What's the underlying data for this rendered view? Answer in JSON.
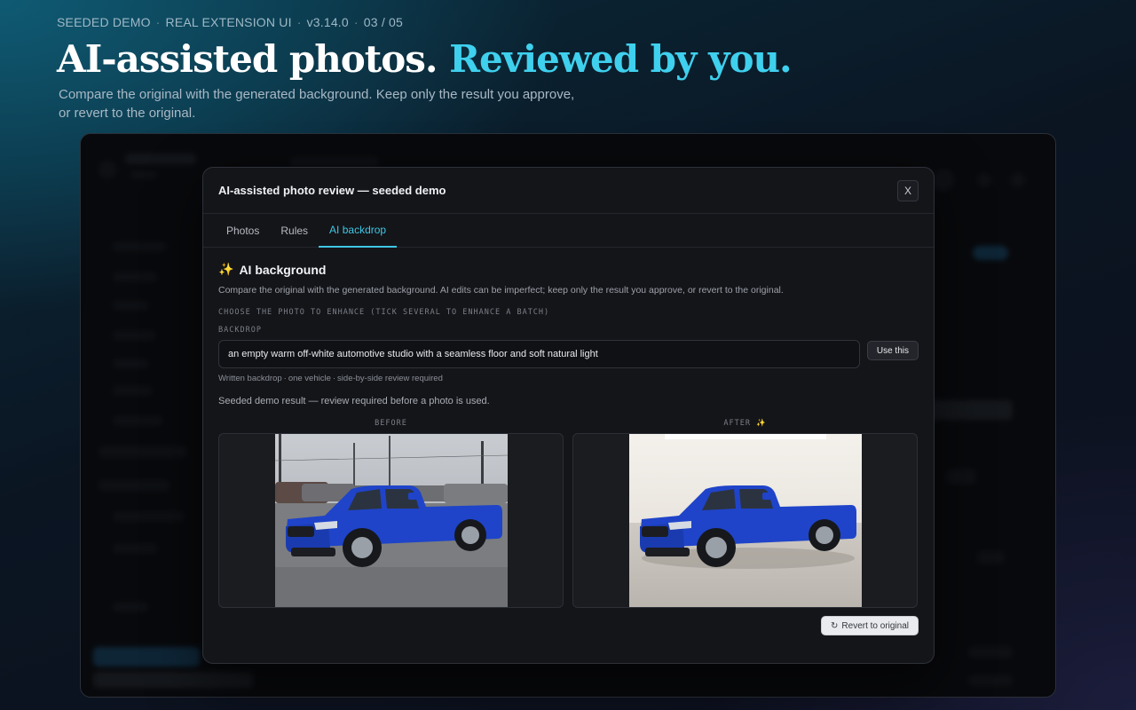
{
  "hero": {
    "kicker": [
      "SEEDED DEMO",
      "REAL EXTENSION UI",
      "v3.14.0",
      "03 / 05"
    ],
    "headline_main": "AI-assisted photos.",
    "headline_accent": "Reviewed by you.",
    "subhead_line1": "Compare the original with the generated background. Keep only the result you approve,",
    "subhead_line2": "or revert to the original."
  },
  "modal": {
    "title": "AI-assisted photo review — seeded demo",
    "close_label": "X",
    "tabs": [
      {
        "label": "Photos",
        "active": false
      },
      {
        "label": "Rules",
        "active": false
      },
      {
        "label": "AI backdrop",
        "active": true
      }
    ],
    "section_icon": "✨",
    "section_title": "AI background",
    "description": "Compare the original with the generated background. AI edits can be imperfect; keep only the result you approve, or revert to the original.",
    "choose_label": "CHOOSE THE PHOTO TO ENHANCE (TICK SEVERAL TO ENHANCE A BATCH)",
    "backdrop_label": "BACKDROP",
    "backdrop_value": "an empty warm off-white automotive studio with a seamless floor and soft natural light",
    "use_button": "Use this",
    "hint": [
      "Written backdrop",
      "one vehicle",
      "side-by-side review required"
    ],
    "result_note": "Seeded demo result — review required before a photo is used.",
    "before_label": "BEFORE",
    "after_label": "AFTER ✨",
    "revert_button": "Revert to original",
    "revert_icon": "↻"
  },
  "colors": {
    "accent": "#3fd0ee",
    "tab_active": "#3fc6e4",
    "truck_blue": "#1f44c9"
  }
}
